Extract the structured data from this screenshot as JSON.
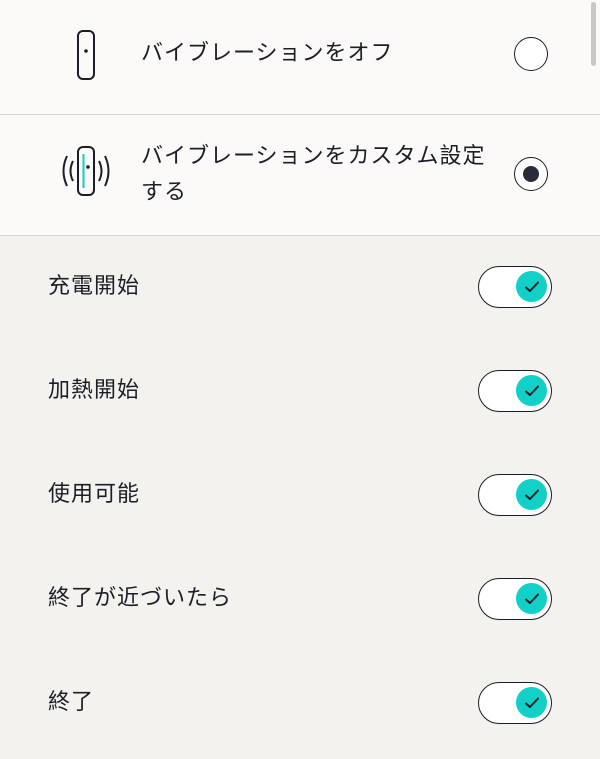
{
  "vibration_options": [
    {
      "label": "バイブレーションをオフ",
      "selected": false,
      "icon": "device-icon"
    },
    {
      "label": "バイブレーションをカスタム設定する",
      "selected": true,
      "icon": "device-vibrating-icon"
    }
  ],
  "toggles": [
    {
      "label": "充電開始",
      "on": true
    },
    {
      "label": "加熱開始",
      "on": true
    },
    {
      "label": "使用可能",
      "on": true
    },
    {
      "label": "終了が近づいたら",
      "on": true
    },
    {
      "label": "終了",
      "on": true
    }
  ],
  "colors": {
    "accent": "#12cfc8",
    "text": "#1c1d26",
    "list_background": "#f3f2ef",
    "options_background": "#fbfaf8",
    "divider": "#d6d5d1"
  }
}
